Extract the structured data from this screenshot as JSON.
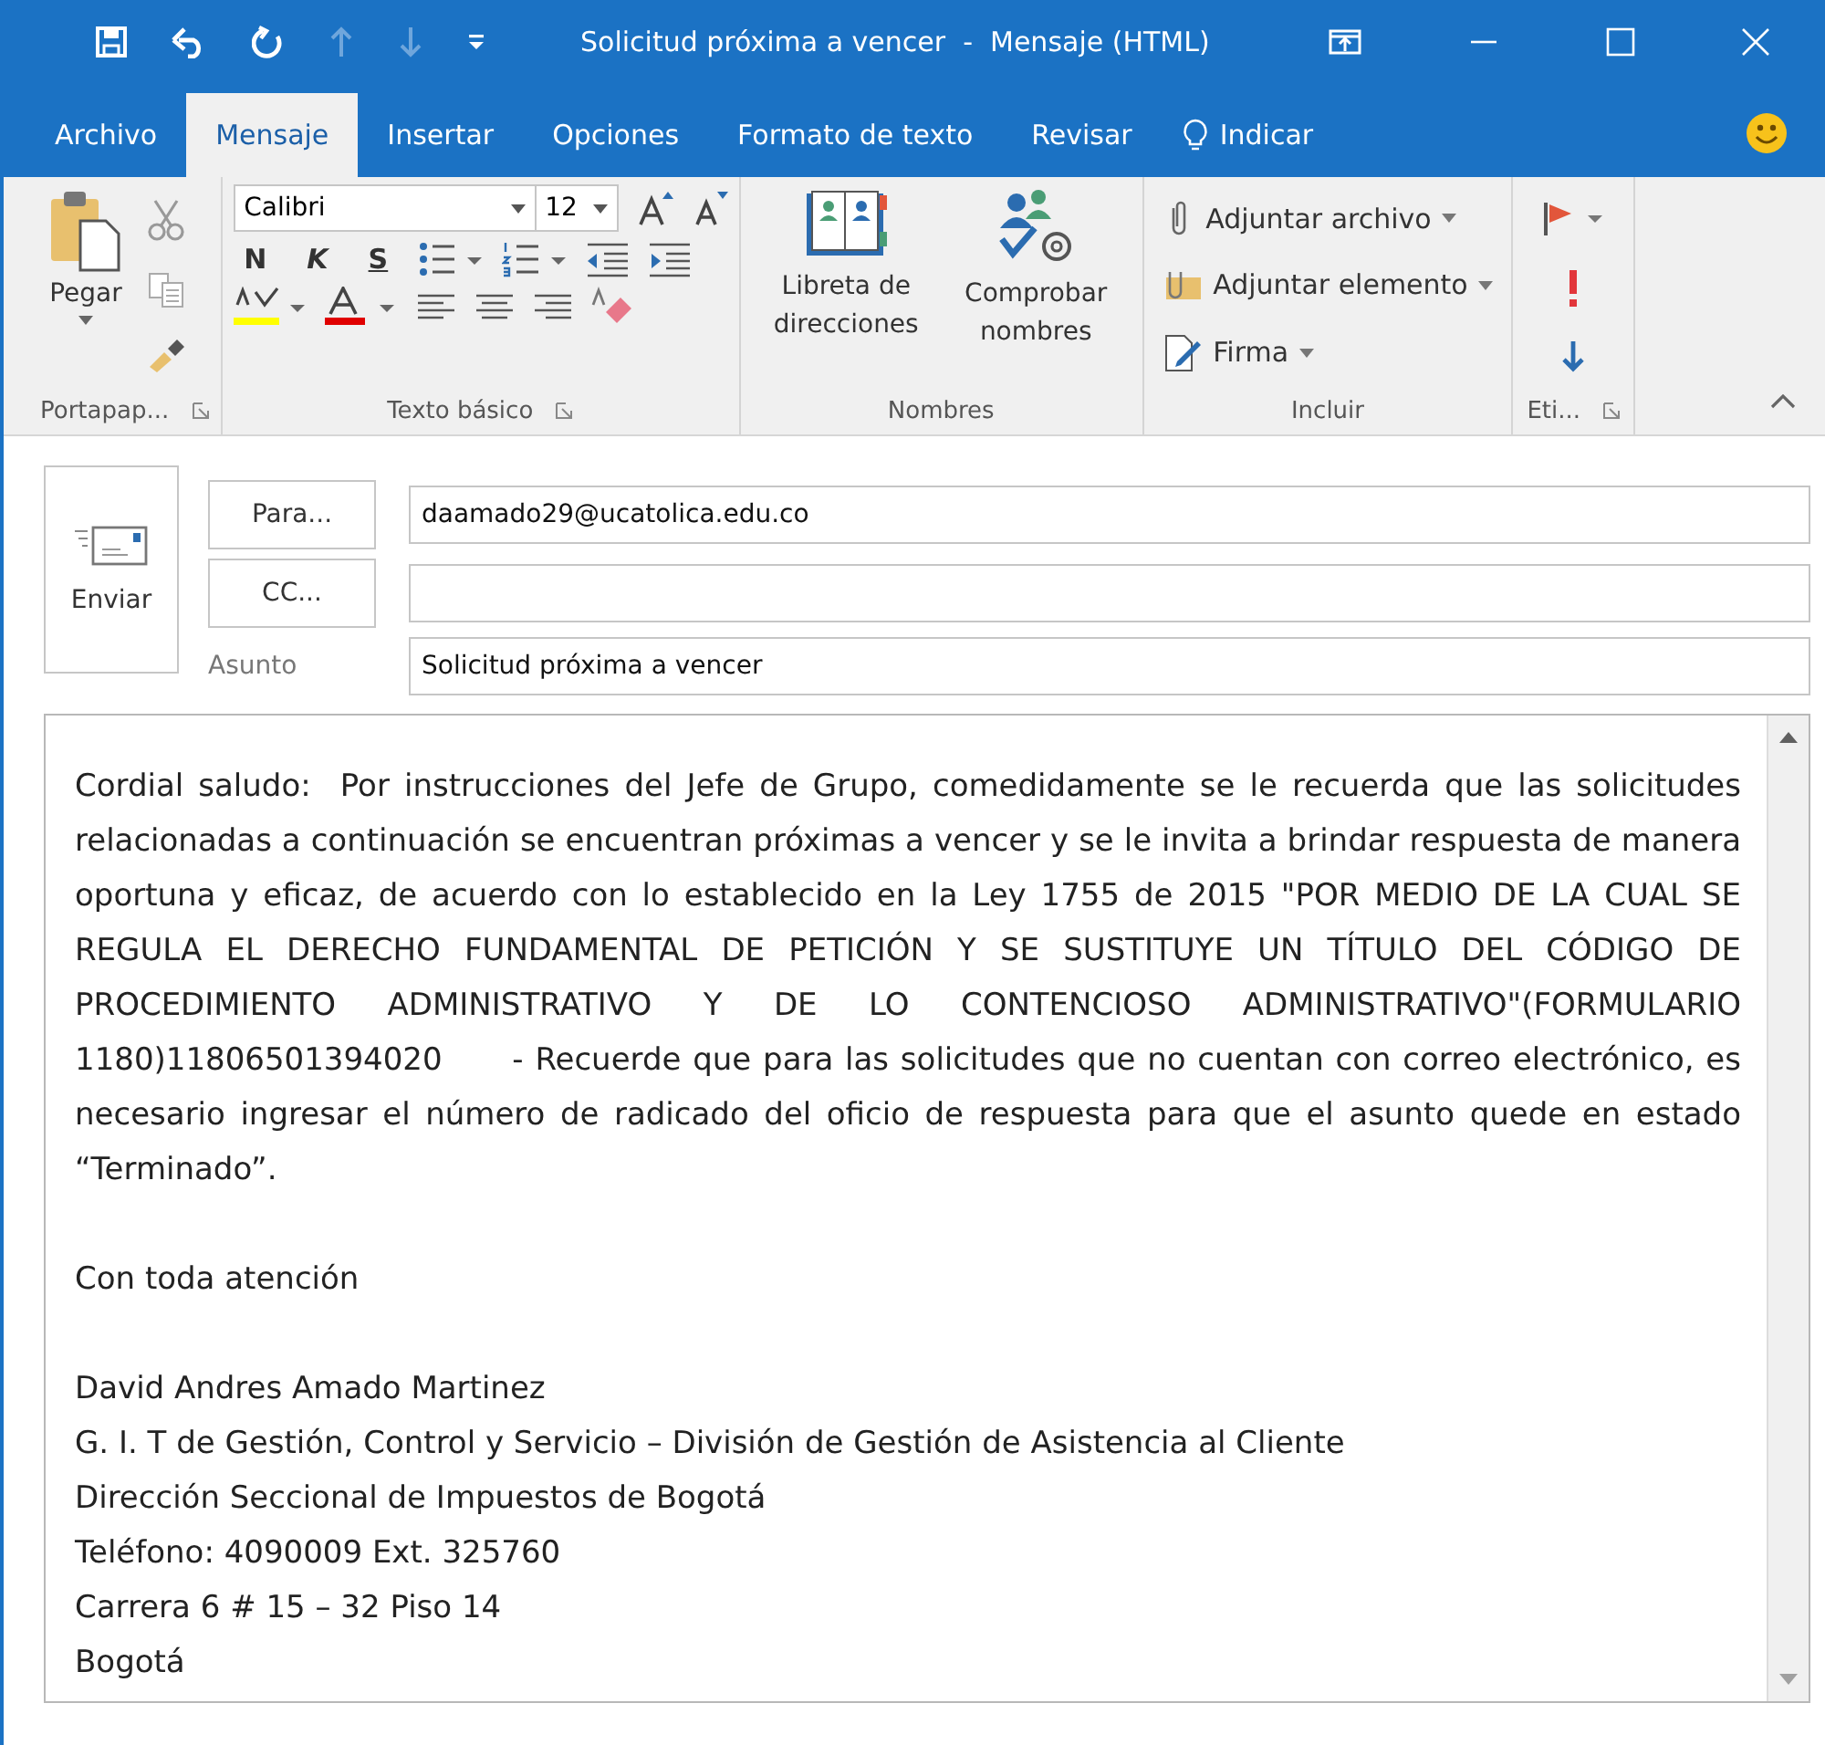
{
  "window": {
    "title": "Solicitud próxima a vencer  -  Mensaje (HTML)"
  },
  "tabs": [
    {
      "label": "Archivo",
      "selected": false
    },
    {
      "label": "Mensaje",
      "selected": true
    },
    {
      "label": "Insertar",
      "selected": false
    },
    {
      "label": "Opciones",
      "selected": false
    },
    {
      "label": "Formato de texto",
      "selected": false
    },
    {
      "label": "Revisar",
      "selected": false
    }
  ],
  "tell_me": "Indicar",
  "ribbon": {
    "clipboard": {
      "paste": "Pegar",
      "label": "Portapap..."
    },
    "basic_text": {
      "font": "Calibri",
      "size": "12",
      "bold": "N",
      "italic": "K",
      "underline": "S",
      "label": "Texto básico"
    },
    "names": {
      "buttons": [
        "Libreta de direcciones",
        "Comprobar nombres"
      ],
      "label": "Nombres"
    },
    "include": {
      "items": [
        "Adjuntar archivo",
        "Adjuntar elemento",
        "Firma"
      ],
      "label": "Incluir"
    },
    "tags": {
      "label": "Eti..."
    }
  },
  "compose": {
    "send": "Enviar",
    "to_button": "Para...",
    "to": "daamado29@ucatolica.edu.co",
    "cc_button": "CC...",
    "subject_label": "Asunto",
    "subject": "Solicitud próxima a vencer"
  },
  "body": {
    "paragraph": "Cordial saludo:  Por instrucciones del Jefe de Grupo, comedidamente se le recuerda que las solicitudes relacionadas a continuación se encuentran próximas a vencer y se le invita a brindar respuesta de manera oportuna y eficaz, de acuerdo con lo establecido en la Ley 1755 de 2015 \"POR MEDIO DE LA CUAL SE REGULA EL DERECHO FUNDAMENTAL DE PETICIÓN Y SE SUSTITUYE UN TÍTULO DEL CÓDIGO DE PROCEDIMIENTO ADMINISTRATIVO Y DE LO CONTENCIOSO ADMINISTRATIVO\"(FORMULARIO 1180)11806501394020      - Recuerde que para las solicitudes que no cuentan con correo electrónico, es necesario ingresar el número de radicado del oficio de respuesta para que el asunto quede en estado “Terminado”.",
    "closing": "Con toda atención",
    "signature": [
      "David Andres Amado Martinez",
      "G. I. T de Gestión, Control y Servicio – División de Gestión de Asistencia al Cliente",
      "Dirección Seccional de Impuestos de Bogotá",
      "Teléfono: 4090009 Ext. 325760",
      "Carrera 6 # 15 – 32 Piso 14",
      "Bogotá"
    ]
  }
}
